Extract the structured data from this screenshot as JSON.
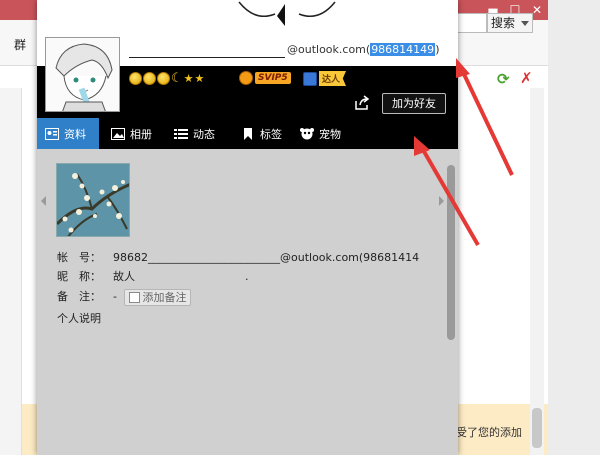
{
  "bg_window": {
    "minimize": "▬",
    "maximize": "☐",
    "close": "✕",
    "toolbar_left": "群",
    "search_button": "搜索",
    "refresh": "⟳",
    "close_x": "✗",
    "notification": "受了您的添加"
  },
  "profile": {
    "email": "@outlook.com(",
    "email_number": "986814149",
    "email_close": ")",
    "badges": {
      "svip": "SVIP5",
      "daren": "达人"
    },
    "add_friend": "加为好友",
    "tabs": [
      {
        "label": "资料",
        "icon": "profile-card-icon",
        "active": true
      },
      {
        "label": "相册",
        "icon": "album-icon",
        "active": false
      },
      {
        "label": "动态",
        "icon": "list-icon",
        "active": false
      },
      {
        "label": "标签",
        "icon": "bookmark-icon",
        "active": false
      },
      {
        "label": "宠物",
        "icon": "pet-icon",
        "active": false
      }
    ],
    "fields": {
      "account_label": "帐　号：",
      "account_value": "98682________________________@outlook.com(98681414",
      "nickname_label": "昵　称：",
      "nickname_value": "故人　　　　　　　　　　.",
      "remark_label": "备　注：",
      "remark_value": "-",
      "add_remark": "添加备注",
      "bio_label": "个人说明"
    }
  },
  "colors": {
    "accent_tab": "#2f80c9",
    "highlight": "#3a8ee6",
    "bg_titlebar": "#c9545a",
    "arrow": "#e53935"
  }
}
